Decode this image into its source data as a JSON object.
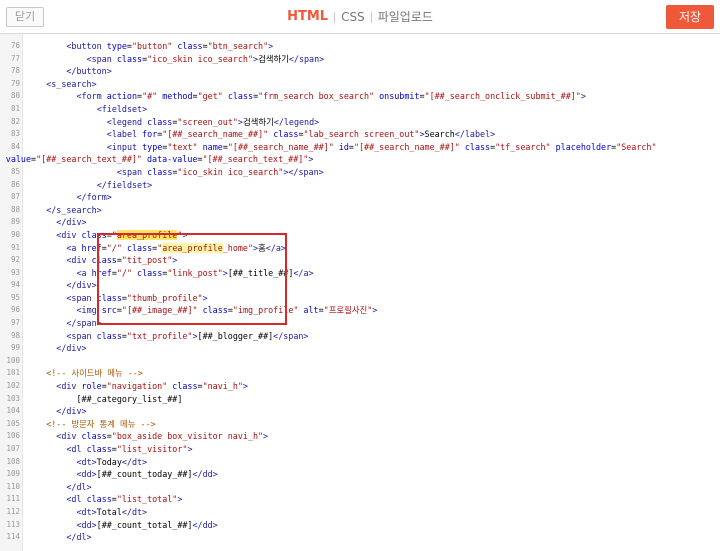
{
  "toolbar": {
    "close_label": "닫기",
    "tabs": [
      {
        "label": "HTML",
        "active": true
      },
      {
        "label": "CSS",
        "active": false
      },
      {
        "label": "파일업로드",
        "active": false
      }
    ],
    "save_label": "저장"
  },
  "colors": {
    "accent": "#f0583a",
    "highlight_box": "#d62a2a",
    "tag": "#1a1aa6",
    "attr": "#0000cc",
    "value": "#a11",
    "comment": "#aa5500"
  },
  "editor": {
    "lines": [
      {
        "n": "76",
        "indent": 8,
        "html": "<span class=\"t\">&lt;button</span> <span class=\"a\">type</span>=<span class=\"v\">\"button\"</span> <span class=\"a\">class</span>=<span class=\"v\">\"btn_search\"</span><span class=\"t\">&gt;</span>"
      },
      {
        "n": "77",
        "indent": 12,
        "html": "<span class=\"t\">&lt;span</span> <span class=\"a\">class</span>=<span class=\"v\">\"ico_skin ico_search\"</span><span class=\"t\">&gt;</span>검색하기<span class=\"t\">&lt;/span&gt;</span>"
      },
      {
        "n": "78",
        "indent": 8,
        "html": "<span class=\"t\">&lt;/button&gt;</span>"
      },
      {
        "n": "79",
        "indent": 4,
        "html": "<span class=\"t\">&lt;s_search&gt;</span>"
      },
      {
        "n": "80",
        "indent": 10,
        "html": "<span class=\"t\">&lt;form</span> <span class=\"a\">action</span>=<span class=\"v\">\"#\"</span> <span class=\"a\">method</span>=<span class=\"v\">\"get\"</span> <span class=\"a\">class</span>=<span class=\"v\">\"frm_search box_search\"</span> <span class=\"a\">onsubmit</span>=<span class=\"v\">\"[##_search_onclick_submit_##]\"</span><span class=\"t\">&gt;</span>"
      },
      {
        "n": "81",
        "indent": 14,
        "html": "<span class=\"t\">&lt;fieldset&gt;</span>"
      },
      {
        "n": "82",
        "indent": 16,
        "html": "<span class=\"t\">&lt;legend</span> <span class=\"a\">class</span>=<span class=\"v\">\"screen_out\"</span><span class=\"t\">&gt;</span>검색하기<span class=\"t\">&lt;/legend&gt;</span>"
      },
      {
        "n": "83",
        "indent": 16,
        "html": "<span class=\"t\">&lt;label</span> <span class=\"a\">for</span>=<span class=\"v\">\"[##_search_name_##]\"</span> <span class=\"a\">class</span>=<span class=\"v\">\"lab_search screen_out\"</span><span class=\"t\">&gt;</span>Search<span class=\"t\">&lt;/label&gt;</span>"
      },
      {
        "n": "84",
        "indent": 16,
        "html": "<span class=\"t\">&lt;input</span> <span class=\"a\">type</span>=<span class=\"v\">\"text\"</span> <span class=\"a\">name</span>=<span class=\"v\">\"[##_search_name_##]\"</span> <span class=\"a\">id</span>=<span class=\"v\">\"[##_search_name_##]\"</span> <span class=\"a\">class</span>=<span class=\"v\">\"tf_search\"</span> <span class=\"a\">placeholder</span>=<span class=\"v\">\"Search\"</span>"
      },
      {
        "n": "",
        "indent": -4,
        "html": "<span class=\"a\">value</span>=<span class=\"v\">\"[##_search_text_##]\"</span> <span class=\"a\">data-value</span>=<span class=\"v\">\"[##_search_text_##]\"</span><span class=\"t\">&gt;</span>"
      },
      {
        "n": "85",
        "indent": 18,
        "html": "<span class=\"t\">&lt;span</span> <span class=\"a\">class</span>=<span class=\"v\">\"ico_skin ico_search\"</span><span class=\"t\">&gt;&lt;/span&gt;</span>"
      },
      {
        "n": "86",
        "indent": 14,
        "html": "<span class=\"t\">&lt;/fieldset&gt;</span>"
      },
      {
        "n": "87",
        "indent": 10,
        "html": "<span class=\"t\">&lt;/form&gt;</span>"
      },
      {
        "n": "88",
        "indent": 4,
        "html": "<span class=\"t\">&lt;/s_search&gt;</span>"
      },
      {
        "n": "89",
        "indent": 6,
        "html": "<span class=\"t\">&lt;/div&gt;</span>"
      },
      {
        "n": "90",
        "indent": 6,
        "html": "<span class=\"t\">&lt;div</span> <span class=\"a\">class</span>=<span class=\"v\">\"<span class=\"hl2\">area_profile</span>\"</span><span class=\"t\">&gt;</span>"
      },
      {
        "n": "91",
        "indent": 8,
        "html": "<span class=\"t\">&lt;a</span> <span class=\"a\">href</span>=<span class=\"v\">\"/\"</span> <span class=\"a\">class</span>=<span class=\"v\">\"<span class=\"hl\">area_profile</span>_home\"</span><span class=\"t\">&gt;</span>홈<span class=\"t\">&lt;/a&gt;</span>"
      },
      {
        "n": "92",
        "indent": 8,
        "html": "<span class=\"t\">&lt;div</span> <span class=\"a\">class</span>=<span class=\"v\">\"tit_post\"</span><span class=\"t\">&gt;</span>"
      },
      {
        "n": "93",
        "indent": 10,
        "html": "<span class=\"t\">&lt;a</span> <span class=\"a\">href</span>=<span class=\"v\">\"/\"</span> <span class=\"a\">class</span>=<span class=\"v\">\"link_post\"</span><span class=\"t\">&gt;</span>[##_title_##]<span class=\"t\">&lt;/a&gt;</span>"
      },
      {
        "n": "94",
        "indent": 8,
        "html": "<span class=\"t\">&lt;/div&gt;</span>"
      },
      {
        "n": "95",
        "indent": 8,
        "html": "<span class=\"t\">&lt;span</span> <span class=\"a\">class</span>=<span class=\"v\">\"thumb_profile\"</span><span class=\"t\">&gt;</span>"
      },
      {
        "n": "96",
        "indent": 10,
        "html": "<span class=\"t\">&lt;img</span> <span class=\"a\">src</span>=<span class=\"v\">\"[##_image_##]\"</span> <span class=\"a\">class</span>=<span class=\"v\">\"img_profile\"</span> <span class=\"a\">alt</span>=<span class=\"v\">\"프로필사진\"</span><span class=\"t\">&gt;</span>"
      },
      {
        "n": "97",
        "indent": 8,
        "html": "<span class=\"t\">&lt;/span&gt;</span>"
      },
      {
        "n": "98",
        "indent": 8,
        "html": "<span class=\"t\">&lt;span</span> <span class=\"a\">class</span>=<span class=\"v\">\"txt_profile\"</span><span class=\"t\">&gt;</span>[##_blogger_##]<span class=\"t\">&lt;/span&gt;</span>"
      },
      {
        "n": "99",
        "indent": 6,
        "html": "<span class=\"t\">&lt;/div&gt;</span>"
      },
      {
        "n": "100",
        "indent": 0,
        "html": ""
      },
      {
        "n": "101",
        "indent": 4,
        "html": "<span class=\"cm\">&lt;!-- 사이드바 메뉴 --&gt;</span>"
      },
      {
        "n": "102",
        "indent": 6,
        "html": "<span class=\"t\">&lt;div</span> <span class=\"a\">role</span>=<span class=\"v\">\"navigation\"</span> <span class=\"a\">class</span>=<span class=\"v\">\"navi_h\"</span><span class=\"t\">&gt;</span>"
      },
      {
        "n": "103",
        "indent": 10,
        "html": "[##_category_list_##]"
      },
      {
        "n": "104",
        "indent": 6,
        "html": "<span class=\"t\">&lt;/div&gt;</span>"
      },
      {
        "n": "105",
        "indent": 4,
        "html": "<span class=\"cm\">&lt;!-- 방문자 통계 메뉴 --&gt;</span>"
      },
      {
        "n": "106",
        "indent": 6,
        "html": "<span class=\"t\">&lt;div</span> <span class=\"a\">class</span>=<span class=\"v\">\"box_aside box_visitor navi_h\"</span><span class=\"t\">&gt;</span>"
      },
      {
        "n": "107",
        "indent": 8,
        "html": "<span class=\"t\">&lt;dl</span> <span class=\"a\">class</span>=<span class=\"v\">\"list_visitor\"</span><span class=\"t\">&gt;</span>"
      },
      {
        "n": "108",
        "indent": 10,
        "html": "<span class=\"t\">&lt;dt&gt;</span>Today<span class=\"t\">&lt;/dt&gt;</span>"
      },
      {
        "n": "109",
        "indent": 10,
        "html": "<span class=\"t\">&lt;dd&gt;</span>[##_count_today_##]<span class=\"t\">&lt;/dd&gt;</span>"
      },
      {
        "n": "110",
        "indent": 8,
        "html": "<span class=\"t\">&lt;/dl&gt;</span>"
      },
      {
        "n": "111",
        "indent": 8,
        "html": "<span class=\"t\">&lt;dl</span> <span class=\"a\">class</span>=<span class=\"v\">\"list_total\"</span><span class=\"t\">&gt;</span>"
      },
      {
        "n": "112",
        "indent": 10,
        "html": "<span class=\"t\">&lt;dt&gt;</span>Total<span class=\"t\">&lt;/dt&gt;</span>"
      },
      {
        "n": "113",
        "indent": 10,
        "html": "<span class=\"t\">&lt;dd&gt;</span>[##_count_total_##]<span class=\"t\">&lt;/dd&gt;</span>"
      },
      {
        "n": "114",
        "indent": 8,
        "html": "<span class=\"t\">&lt;/dl&gt;</span>"
      }
    ]
  }
}
